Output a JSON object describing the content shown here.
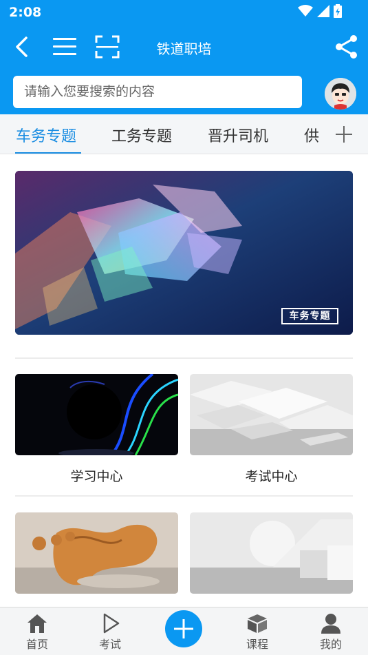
{
  "status_bar": {
    "time": "2:08"
  },
  "header": {
    "title": "铁道职培",
    "search_placeholder": "请输入您要搜索的内容"
  },
  "tabs": [
    {
      "label": "车务专题",
      "active": true
    },
    {
      "label": "工务专题",
      "active": false
    },
    {
      "label": "晋升司机",
      "active": false
    },
    {
      "label": "供",
      "active": false
    }
  ],
  "banner": {
    "tag": "车务专题"
  },
  "cards": [
    {
      "label": "学习中心"
    },
    {
      "label": "考试中心"
    }
  ],
  "bottom_nav": {
    "home": "首页",
    "exam": "考试",
    "course": "课程",
    "mine": "我的"
  },
  "colors": {
    "primary": "#0a98f2",
    "accent": "#1a8de2"
  }
}
